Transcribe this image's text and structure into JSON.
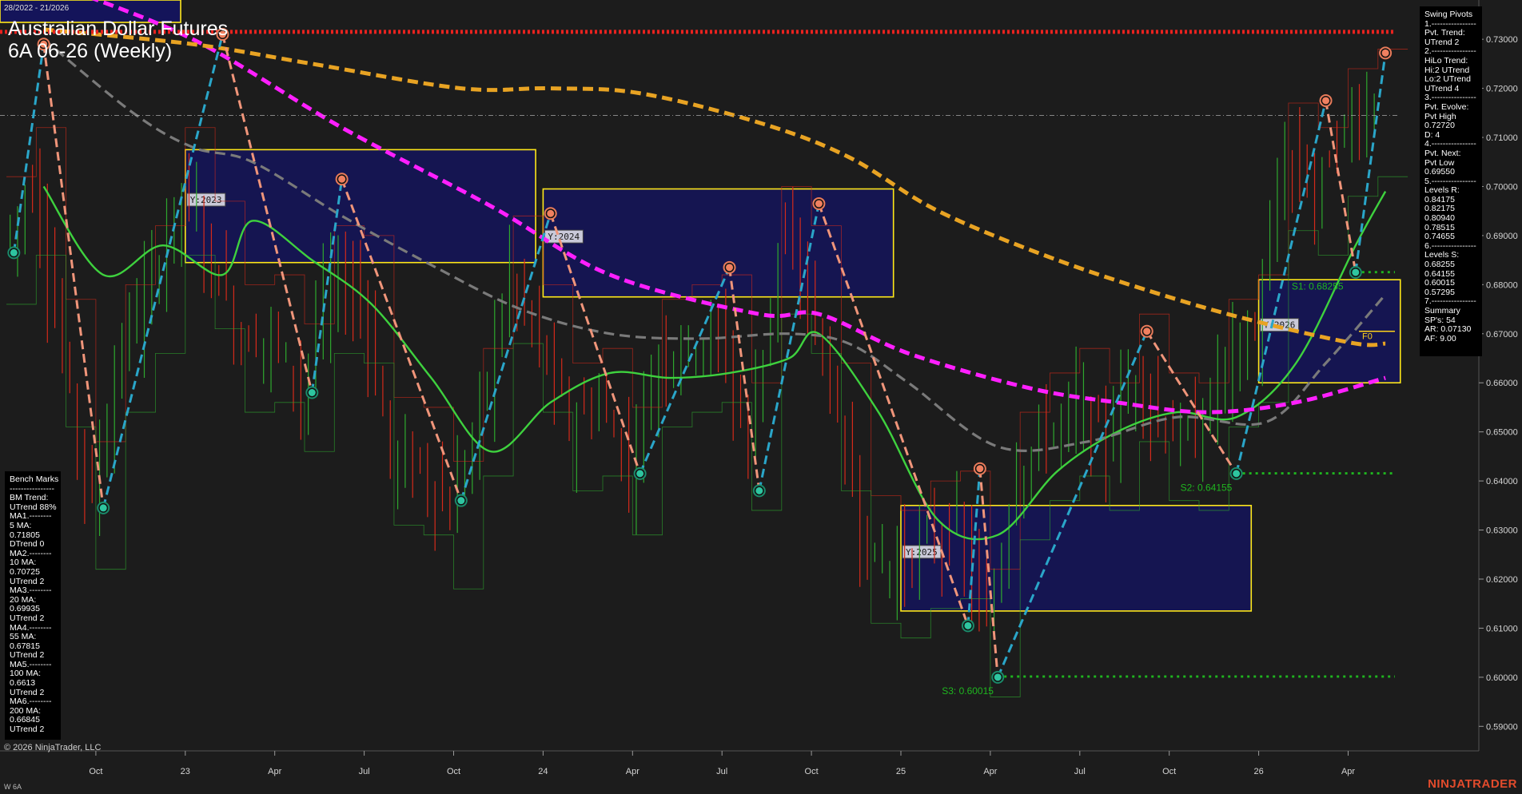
{
  "header": {
    "date_range": "28/2022 - 21/2026",
    "title_line1": "Australian Dollar Futures",
    "title_line2": "6A 06-26 (Weekly)"
  },
  "footer": {
    "copyright": "© 2026 NinjaTrader, LLC",
    "brand": "NINJATRADER",
    "instrument": "W 6A"
  },
  "colors": {
    "background": "#1c1c1c",
    "up_bar": "#2ea82e",
    "down_bar": "#d42a1a",
    "ma_green": "#3ed13e",
    "ma_gray": "#7a7a7a",
    "ma_magenta": "#ff1fff",
    "ma_orange": "#e8a323",
    "pivot_up_line": "#2aa6c9",
    "pivot_down_line": "#f0957a",
    "box_fill": "#14145a",
    "box_border": "#ffe81a",
    "resistance": "#e8231f",
    "support": "#1fb51f"
  },
  "benchmarks": {
    "text": "Bench Marks\n----------------\nBM Trend:\nUTrend 88%\nMA1.--------\n5 MA:\n0.71805\nDTrend 0\nMA2.--------\n10 MA:\n0.70725\nUTrend 2\nMA3.--------\n20 MA:\n0.69935\nUTrend 2\nMA4.--------\n55 MA:\n0.67815\nUTrend 2\nMA5.--------\n100 MA:\n0.6613\nUTrend 2\nMA6.--------\n200 MA:\n0.66845\nUTrend 2"
  },
  "swing_pivots": {
    "text": "Swing Pivots\n1.----------------\nPvt. Trend:\nUTrend 2\n2.----------------\nHiLo Trend:\nHi:2 UTrend\nLo:2 UTrend\nUTrend 4\n3.----------------\nPvt. Evolve:\nPvt High\n0.72720\nD: 4\n4.----------------\nPvt. Next:\nPvt Low\n0.69550\n5.----------------\nLevels R:\n0.84175\n0.82175\n0.80940\n0.78515\n0.74655\n6.----------------\nLevels S:\n0.68255\n0.64155\n0.60015\n0.57295\n7.----------------\nSummary\nSP's: 54\nAR: 0.07130\nAF: 9.00"
  },
  "chart_data": {
    "type": "candlestick",
    "timeframe": "Weekly",
    "ylim": [
      0.585,
      0.738
    ],
    "y_ticks": [
      "0.73000",
      "0.72000",
      "0.71000",
      "0.70000",
      "0.69000",
      "0.68000",
      "0.67000",
      "0.66000",
      "0.65000",
      "0.64000",
      "0.63000",
      "0.62000",
      "0.61000",
      "0.60000",
      "0.59000"
    ],
    "x_labels": [
      {
        "label": "Oct",
        "date": "2022-10"
      },
      {
        "label": "23",
        "date": "2023-01"
      },
      {
        "label": "Apr",
        "date": "2023-04"
      },
      {
        "label": "Jul",
        "date": "2023-07"
      },
      {
        "label": "Oct",
        "date": "2023-10"
      },
      {
        "label": "24",
        "date": "2024-01"
      },
      {
        "label": "Apr",
        "date": "2024-04"
      },
      {
        "label": "Jul",
        "date": "2024-07"
      },
      {
        "label": "Oct",
        "date": "2024-10"
      },
      {
        "label": "25",
        "date": "2025-01"
      },
      {
        "label": "Apr",
        "date": "2025-04"
      },
      {
        "label": "Jul",
        "date": "2025-07"
      },
      {
        "label": "Oct",
        "date": "2025-10"
      },
      {
        "label": "26",
        "date": "2026-01"
      },
      {
        "label": "Apr",
        "date": "2026-04"
      }
    ],
    "price_path": [
      {
        "date": "2022-07",
        "v": 0.69
      },
      {
        "date": "2022-08",
        "v": 0.7
      },
      {
        "date": "2022-09",
        "v": 0.665
      },
      {
        "date": "2022-10",
        "v": 0.636
      },
      {
        "date": "2022-11",
        "v": 0.668
      },
      {
        "date": "2022-12",
        "v": 0.68
      },
      {
        "date": "2023-01",
        "v": 0.7
      },
      {
        "date": "2023-02",
        "v": 0.685
      },
      {
        "date": "2023-03",
        "v": 0.668
      },
      {
        "date": "2023-04",
        "v": 0.67
      },
      {
        "date": "2023-05",
        "v": 0.66
      },
      {
        "date": "2023-06",
        "v": 0.68
      },
      {
        "date": "2023-07",
        "v": 0.678
      },
      {
        "date": "2023-08",
        "v": 0.645
      },
      {
        "date": "2023-09",
        "v": 0.643
      },
      {
        "date": "2023-10",
        "v": 0.632
      },
      {
        "date": "2023-11",
        "v": 0.655
      },
      {
        "date": "2023-12",
        "v": 0.682
      },
      {
        "date": "2024-01",
        "v": 0.668
      },
      {
        "date": "2024-02",
        "v": 0.652
      },
      {
        "date": "2024-03",
        "v": 0.655
      },
      {
        "date": "2024-04",
        "v": 0.643
      },
      {
        "date": "2024-05",
        "v": 0.665
      },
      {
        "date": "2024-06",
        "v": 0.668
      },
      {
        "date": "2024-07",
        "v": 0.67
      },
      {
        "date": "2024-08",
        "v": 0.648
      },
      {
        "date": "2024-09",
        "v": 0.688
      },
      {
        "date": "2024-10",
        "v": 0.68
      },
      {
        "date": "2024-11",
        "v": 0.652
      },
      {
        "date": "2024-12",
        "v": 0.625
      },
      {
        "date": "2025-01",
        "v": 0.622
      },
      {
        "date": "2025-02",
        "v": 0.628
      },
      {
        "date": "2025-03",
        "v": 0.63
      },
      {
        "date": "2025-04",
        "v": 0.61
      },
      {
        "date": "2025-05",
        "v": 0.642
      },
      {
        "date": "2025-06",
        "v": 0.65
      },
      {
        "date": "2025-07",
        "v": 0.655
      },
      {
        "date": "2025-08",
        "v": 0.648
      },
      {
        "date": "2025-09",
        "v": 0.662
      },
      {
        "date": "2025-10",
        "v": 0.65
      },
      {
        "date": "2025-11",
        "v": 0.648
      },
      {
        "date": "2025-12",
        "v": 0.665
      },
      {
        "date": "2026-01",
        "v": 0.67
      },
      {
        "date": "2026-02",
        "v": 0.705
      },
      {
        "date": "2026-03",
        "v": 0.7
      },
      {
        "date": "2026-04",
        "v": 0.712
      },
      {
        "date": "2026-05",
        "v": 0.716
      }
    ],
    "moving_averages": [
      {
        "name": "5 MA",
        "color": "#3ed13e",
        "style": "solid",
        "points": [
          {
            "date": "2022-08",
            "v": 0.7
          },
          {
            "date": "2022-10",
            "v": 0.682
          },
          {
            "date": "2022-12",
            "v": 0.688
          },
          {
            "date": "2023-02",
            "v": 0.682
          },
          {
            "date": "2023-03",
            "v": 0.693
          },
          {
            "date": "2023-05",
            "v": 0.685
          },
          {
            "date": "2023-07",
            "v": 0.676
          },
          {
            "date": "2023-09",
            "v": 0.661
          },
          {
            "date": "2023-11",
            "v": 0.646
          },
          {
            "date": "2024-01",
            "v": 0.656
          },
          {
            "date": "2024-03",
            "v": 0.662
          },
          {
            "date": "2024-05",
            "v": 0.661
          },
          {
            "date": "2024-07",
            "v": 0.662
          },
          {
            "date": "2024-09",
            "v": 0.665
          },
          {
            "date": "2024-10",
            "v": 0.67
          },
          {
            "date": "2024-12",
            "v": 0.654
          },
          {
            "date": "2025-02",
            "v": 0.632
          },
          {
            "date": "2025-04",
            "v": 0.629
          },
          {
            "date": "2025-06",
            "v": 0.642
          },
          {
            "date": "2025-08",
            "v": 0.65
          },
          {
            "date": "2025-10",
            "v": 0.654
          },
          {
            "date": "2025-12",
            "v": 0.653
          },
          {
            "date": "2026-02",
            "v": 0.664
          },
          {
            "date": "2026-04",
            "v": 0.688
          },
          {
            "date": "2026-05",
            "v": 0.699
          }
        ]
      },
      {
        "name": "20 MA",
        "color": "#7a7a7a",
        "style": "dash",
        "points": [
          {
            "date": "2022-08",
            "v": 0.73
          },
          {
            "date": "2022-11",
            "v": 0.715
          },
          {
            "date": "2023-01",
            "v": 0.708
          },
          {
            "date": "2023-03",
            "v": 0.705
          },
          {
            "date": "2023-06",
            "v": 0.694
          },
          {
            "date": "2023-09",
            "v": 0.684
          },
          {
            "date": "2023-12",
            "v": 0.675
          },
          {
            "date": "2024-03",
            "v": 0.67
          },
          {
            "date": "2024-06",
            "v": 0.669
          },
          {
            "date": "2024-09",
            "v": 0.67
          },
          {
            "date": "2024-11",
            "v": 0.668
          },
          {
            "date": "2025-01",
            "v": 0.66
          },
          {
            "date": "2025-04",
            "v": 0.647
          },
          {
            "date": "2025-07",
            "v": 0.648
          },
          {
            "date": "2025-10",
            "v": 0.653
          },
          {
            "date": "2026-01",
            "v": 0.652
          },
          {
            "date": "2026-03",
            "v": 0.664
          },
          {
            "date": "2026-05",
            "v": 0.678
          }
        ]
      },
      {
        "name": "55 MA",
        "color": "#ff1fff",
        "style": "dash",
        "points": [
          {
            "date": "2022-08",
            "v": 0.742
          },
          {
            "date": "2023-01",
            "v": 0.73
          },
          {
            "date": "2023-06",
            "v": 0.712
          },
          {
            "date": "2023-11",
            "v": 0.696
          },
          {
            "date": "2024-03",
            "v": 0.682
          },
          {
            "date": "2024-08",
            "v": 0.674
          },
          {
            "date": "2024-10",
            "v": 0.674
          },
          {
            "date": "2025-01",
            "v": 0.666
          },
          {
            "date": "2025-05",
            "v": 0.659
          },
          {
            "date": "2025-08",
            "v": 0.656
          },
          {
            "date": "2025-11",
            "v": 0.654
          },
          {
            "date": "2026-02",
            "v": 0.656
          },
          {
            "date": "2026-05",
            "v": 0.661
          }
        ]
      },
      {
        "name": "200 MA",
        "color": "#e8a323",
        "style": "dash",
        "points": [
          {
            "date": "2022-08",
            "v": 0.732
          },
          {
            "date": "2023-01",
            "v": 0.729
          },
          {
            "date": "2023-05",
            "v": 0.725
          },
          {
            "date": "2023-10",
            "v": 0.72
          },
          {
            "date": "2024-01",
            "v": 0.72
          },
          {
            "date": "2024-04",
            "v": 0.719
          },
          {
            "date": "2024-08",
            "v": 0.713
          },
          {
            "date": "2024-11",
            "v": 0.706
          },
          {
            "date": "2025-02",
            "v": 0.695
          },
          {
            "date": "2025-06",
            "v": 0.685
          },
          {
            "date": "2025-10",
            "v": 0.677
          },
          {
            "date": "2026-01",
            "v": 0.672
          },
          {
            "date": "2026-04",
            "v": 0.668
          },
          {
            "date": "2026-05",
            "v": 0.668
          }
        ]
      }
    ],
    "swing_pivots": [
      {
        "date": "2022-07",
        "v": 0.6865,
        "type": "low"
      },
      {
        "date": "2022-08",
        "v": 0.729,
        "type": "high"
      },
      {
        "date": "2022-10",
        "v": 0.6345,
        "type": "low"
      },
      {
        "date": "2023-02",
        "v": 0.731,
        "type": "high"
      },
      {
        "date": "2023-05",
        "v": 0.658,
        "type": "low"
      },
      {
        "date": "2023-06",
        "v": 0.7015,
        "type": "high"
      },
      {
        "date": "2023-10",
        "v": 0.636,
        "type": "low"
      },
      {
        "date": "2024-01",
        "v": 0.6945,
        "type": "high"
      },
      {
        "date": "2024-04",
        "v": 0.6415,
        "type": "low"
      },
      {
        "date": "2024-07",
        "v": 0.6835,
        "type": "high"
      },
      {
        "date": "2024-08",
        "v": 0.638,
        "type": "low"
      },
      {
        "date": "2024-10",
        "v": 0.6965,
        "type": "high"
      },
      {
        "date": "2025-03",
        "v": 0.6105,
        "type": "low"
      },
      {
        "date": "2025-03b",
        "v": 0.6425,
        "type": "high"
      },
      {
        "date": "2025-04",
        "v": 0.6,
        "type": "low"
      },
      {
        "date": "2025-09",
        "v": 0.6705,
        "type": "high"
      },
      {
        "date": "2025-12",
        "v": 0.6415,
        "type": "low"
      },
      {
        "date": "2026-03",
        "v": 0.7175,
        "type": "high"
      },
      {
        "date": "2026-04",
        "v": 0.6825,
        "type": "low"
      },
      {
        "date": "2026-05",
        "v": 0.7272,
        "type": "high"
      }
    ],
    "yearly_boxes": [
      {
        "label": "Y:2023",
        "from": "2023-01",
        "to": "2023-12",
        "low": 0.6845,
        "high": 0.7075
      },
      {
        "label": "Y:2024",
        "from": "2024-01",
        "to": "2024-12",
        "low": 0.6775,
        "high": 0.6995
      },
      {
        "label": "Y:2025",
        "from": "2025-01",
        "to": "2025-12",
        "low": 0.6135,
        "high": 0.635
      },
      {
        "label": "Y:2026",
        "from": "2026-01",
        "to": "2026-05",
        "low": 0.66,
        "high": 0.681
      }
    ],
    "levels": [
      {
        "label": "S1: 0.68255",
        "v": 0.68255,
        "from": "2026-04",
        "kind": "support"
      },
      {
        "label": "S2: 0.64155",
        "v": 0.64155,
        "from": "2025-12",
        "kind": "support"
      },
      {
        "label": "S3: 0.60015",
        "v": 0.60015,
        "from": "2025-04",
        "kind": "support"
      },
      {
        "label": "",
        "v": 0.7315,
        "from": "2022-07",
        "kind": "resistance"
      }
    ],
    "f0_label": "F0",
    "f0_value": 0.6705,
    "last_price": 0.7145
  }
}
